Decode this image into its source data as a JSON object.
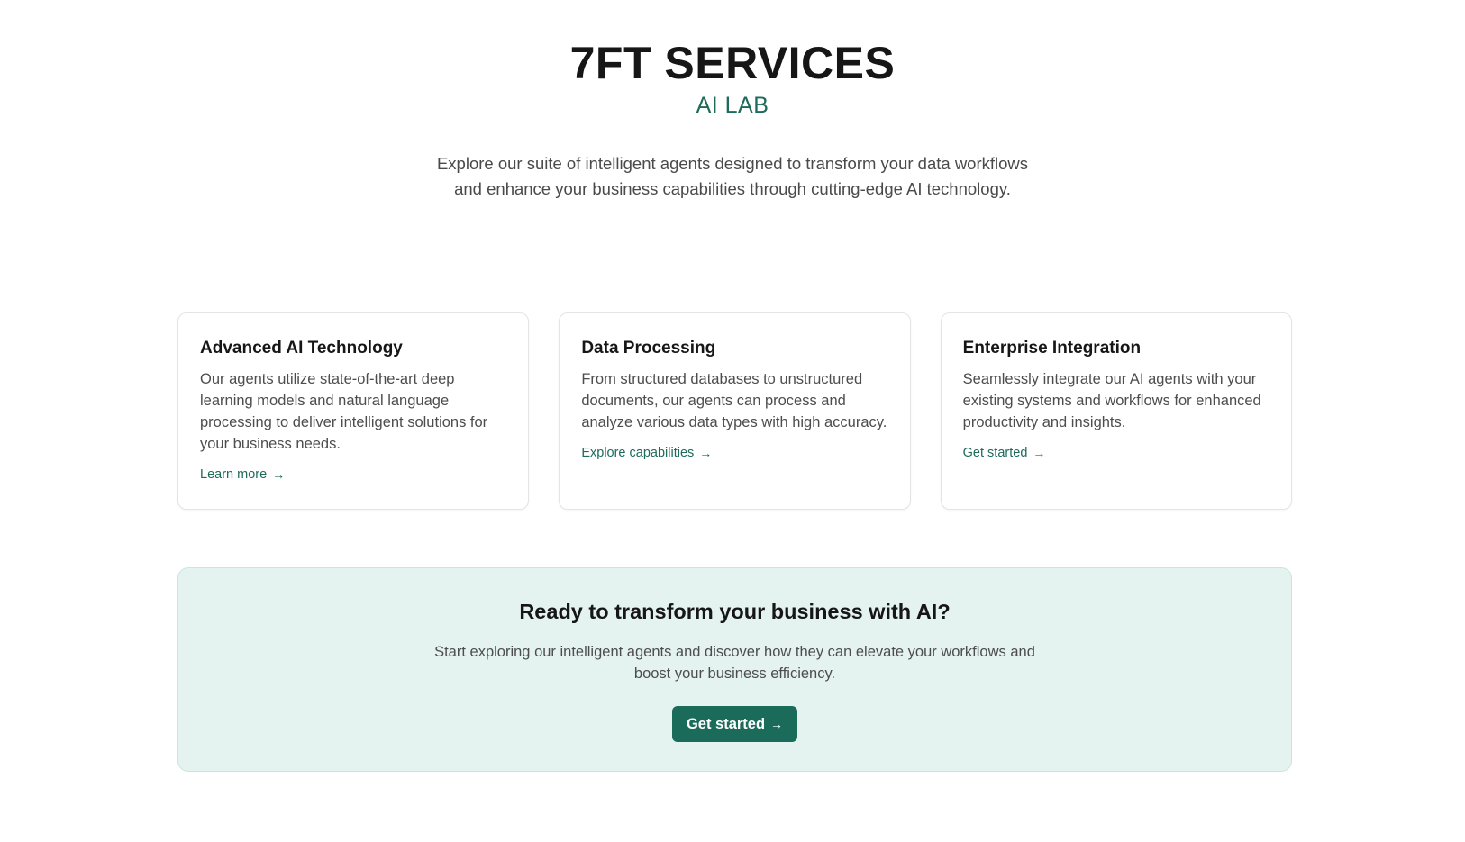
{
  "hero": {
    "title": "7FT SERVICES",
    "subtitle": "AI LAB",
    "intro": "Explore our suite of intelligent agents designed to transform your data workflows and enhance your business capabilities through cutting-edge AI technology."
  },
  "cards": [
    {
      "title": "Advanced AI Technology",
      "body": "Our agents utilize state-of-the-art deep learning models and natural language processing to deliver intelligent solutions for your business needs.",
      "link": "Learn more"
    },
    {
      "title": "Data Processing",
      "body": "From structured databases to unstructured documents, our agents can process and analyze various data types with high accuracy.",
      "link": "Explore capabilities"
    },
    {
      "title": "Enterprise Integration",
      "body": "Seamlessly integrate our AI agents with your existing systems and workflows for enhanced productivity and insights.",
      "link": "Get started"
    }
  ],
  "cta": {
    "heading": "Ready to transform your business with AI?",
    "body": "Start exploring our intelligent agents and discover how they can elevate your workflows and boost your business efficiency.",
    "button": "Get started"
  },
  "icons": {
    "arrow": "arrow-right-icon"
  },
  "colors": {
    "accent": "#1d6b5b",
    "cta_background": "#e4f3ef",
    "button": "#1a6b5a"
  }
}
